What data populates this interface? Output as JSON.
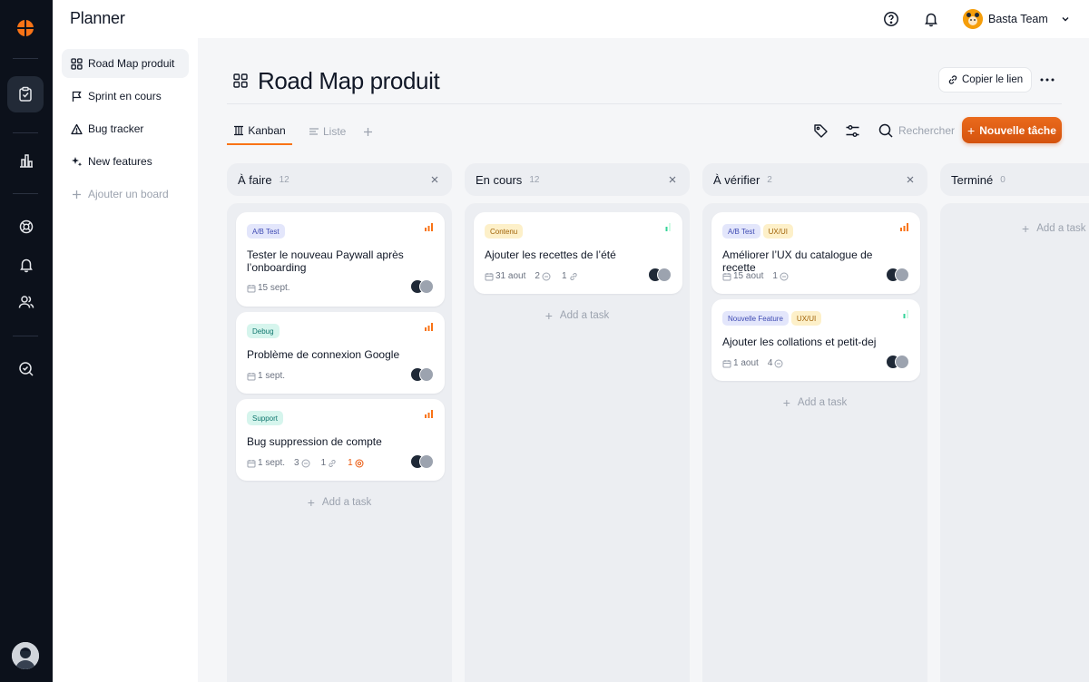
{
  "app": {
    "title": "Planner"
  },
  "topbar": {
    "team_name": "Basta Team"
  },
  "sidebar": {
    "items": [
      {
        "label": "Road Map produit",
        "icon": "grid-icon",
        "active": true
      },
      {
        "label": "Sprint en cours",
        "icon": "flag-icon"
      },
      {
        "label": "Bug tracker",
        "icon": "warning-icon"
      },
      {
        "label": "New features",
        "icon": "sparkle-icon"
      },
      {
        "label": "Ajouter un board",
        "icon": "plus-icon"
      }
    ]
  },
  "board": {
    "title": "Road Map produit",
    "copy_link_label": "Copier le lien",
    "tabs": [
      {
        "label": "Kanban",
        "active": true
      },
      {
        "label": "Liste"
      }
    ],
    "search_placeholder": "Rechercher",
    "new_task_label": "Nouvelle tâche"
  },
  "columns": [
    {
      "title": "À faire",
      "count": "12",
      "cards": [
        {
          "tags": [
            {
              "label": "A/B Test"
            }
          ],
          "title": "Tester le nouveau Paywall après l’onboarding",
          "date": "15 sept."
        },
        {
          "tags": [
            {
              "label": "Debug"
            }
          ],
          "title": "Problème de connexion Google",
          "date": "1 sept."
        },
        {
          "tags": [
            {
              "label": "Support"
            }
          ],
          "title": "Bug suppression de compte",
          "date": "1 sept.",
          "comments": "3",
          "links": "1",
          "bugs": "1"
        }
      ],
      "add_label": "Add a task"
    },
    {
      "title": "En cours",
      "count": "12",
      "cards": [
        {
          "tags": [
            {
              "label": "Contenu"
            }
          ],
          "title": "Ajouter les recettes de l’été",
          "date": "31 aout",
          "comments": "2",
          "links": "1"
        }
      ],
      "add_label": "Add a task"
    },
    {
      "title": "À vérifier",
      "count": "2",
      "cards": [
        {
          "tags": [
            {
              "label": "A/B Test"
            },
            {
              "label": "UX/UI"
            }
          ],
          "title": "Améliorer l’UX du catalogue de recette",
          "date": "15 aout",
          "comments": "1"
        },
        {
          "tags": [
            {
              "label": "Nouvelle Feature"
            },
            {
              "label": "UX/UI"
            }
          ],
          "title": "Ajouter les collations et petit-dej",
          "date": "1 aout",
          "comments": "4"
        }
      ],
      "add_label": "Add a task"
    },
    {
      "title": "Terminé",
      "count": "0",
      "cards": [],
      "add_label": "Add a task"
    }
  ],
  "colors": {
    "accent": "#ea6a1c",
    "rail": "#0c111b",
    "priority_high": "#f97316",
    "priority_low": "#34d399"
  }
}
